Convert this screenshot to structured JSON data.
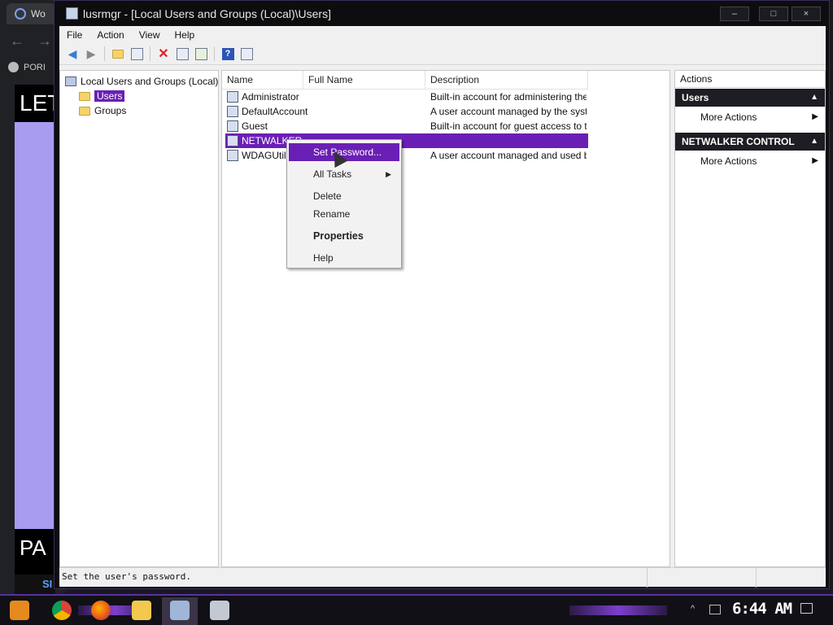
{
  "background": {
    "tab_label": "Wo",
    "bookmark_label": "PORI",
    "page_heading": "LET",
    "page_footer": "PA",
    "page_footer_link": "SI"
  },
  "window": {
    "title": "lusrmgr - [Local Users and Groups (Local)\\Users]",
    "minimize": "–",
    "maximize": "□",
    "close": "×"
  },
  "menu": [
    "File",
    "Action",
    "View",
    "Help"
  ],
  "toolbar_icons": [
    "back-icon",
    "forward-icon",
    "up-folder-icon",
    "show-hide-tree-icon",
    "delete-icon",
    "properties-icon",
    "export-list-icon",
    "help-icon",
    "show-hide-action-pane-icon"
  ],
  "tree": {
    "root": "Local Users and Groups (Local)",
    "items": [
      "Users",
      "Groups"
    ],
    "selected": "Users"
  },
  "list": {
    "columns": [
      "Name",
      "Full Name",
      "Description"
    ],
    "rows": [
      {
        "name": "Administrator",
        "full_name": "",
        "description": "Built-in account for administering the ..."
      },
      {
        "name": "DefaultAccount",
        "full_name": "",
        "description": "A user account managed by the syst..."
      },
      {
        "name": "Guest",
        "full_name": "",
        "description": "Built-in account for guest access to th..."
      },
      {
        "name": "NETWALKER",
        "full_name": "",
        "description": ""
      },
      {
        "name": "WDAGUtilityA",
        "full_name": "",
        "description": "A user account managed and used b..."
      }
    ],
    "selected_row": "NETWALKER"
  },
  "context_menu": {
    "items": [
      "Set Password...",
      "All Tasks",
      "Delete",
      "Rename",
      "Properties",
      "Help"
    ],
    "highlighted": "Set Password..."
  },
  "actions": {
    "title": "Actions",
    "groups": [
      {
        "label": "Users",
        "more": "More Actions"
      },
      {
        "label": "NETWALKER CONTROL",
        "more": "More Actions"
      }
    ]
  },
  "status": "Set the user's password.",
  "taskbar": {
    "clock": "6:44 AM",
    "icons": [
      "start-icon",
      "chrome-icon",
      "firefox-icon",
      "file-explorer-icon",
      "computer-management-icon",
      "performance-monitor-icon"
    ]
  },
  "colors": {
    "selection": "#6a1fb4",
    "accent": "#7d3fd0",
    "action_group_bg": "#1d1d24"
  }
}
